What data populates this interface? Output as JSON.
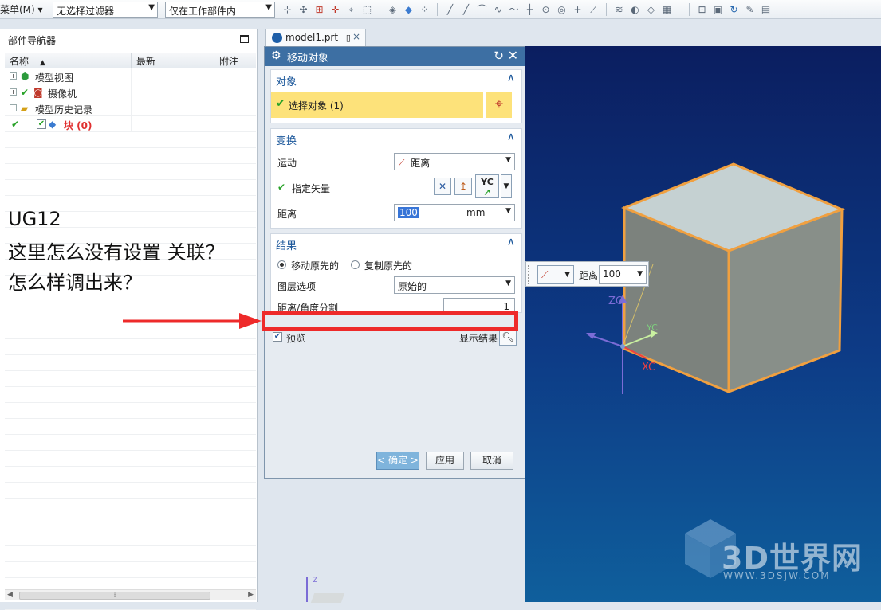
{
  "toolbar": {
    "menu_label": "菜单(M)",
    "filter_value": "无选择过滤器",
    "scope_value": "仅在工作部件内",
    "icons": [
      "snap-icon",
      "point-icon",
      "curve-icon",
      "select-icon",
      "face-icon",
      "body-icon",
      "line-icon",
      "arc-icon",
      "spline-icon",
      "circle-icon",
      "plus-icon",
      "layer-icon",
      "view-icon",
      "refresh-icon",
      "brush-icon"
    ]
  },
  "navigator": {
    "title": "部件导航器",
    "columns": [
      "名称",
      "最新",
      "附注"
    ],
    "rows": [
      {
        "label": "模型视图",
        "indent": 0,
        "expander": "+",
        "icon": "model-view-icon"
      },
      {
        "label": "摄像机",
        "indent": 0,
        "expander": "+",
        "icon": "camera-icon",
        "check": "✔"
      },
      {
        "label": "模型历史记录",
        "indent": 0,
        "expander": "-",
        "icon": "folder-icon"
      },
      {
        "label": "块 (0)",
        "indent": 1,
        "icon": "block-icon",
        "latest": "✔",
        "highlight": true
      }
    ]
  },
  "annotation": {
    "line1": "UG12",
    "line2": "这里怎么没有设置 关联？",
    "line3": "怎么样调出来？"
  },
  "tab": {
    "label": "model1.prt",
    "close": "×"
  },
  "dialog": {
    "title": "移动对象",
    "section_object": {
      "title": "对象",
      "select_label": "选择对象 (1)"
    },
    "section_transform": {
      "title": "变换",
      "motion_label": "运动",
      "motion_value": "距离",
      "vector_label": "指定矢量",
      "vector_value": "YC",
      "distance_label": "距离",
      "distance_value": "100",
      "distance_unit": "mm"
    },
    "section_result": {
      "title": "结果",
      "radio_move": "移动原先的",
      "radio_copy": "复制原先的",
      "layer_label": "图层选项",
      "layer_value": "原始的",
      "split_label": "距离/角度分割",
      "split_value": "1"
    },
    "preview_label": "预览",
    "show_result_label": "显示结果",
    "buttons": {
      "ok": "< 确定 >",
      "apply": "应用",
      "cancel": "取消"
    }
  },
  "float_bar": {
    "distance_label": "距离",
    "distance_value": "100"
  },
  "viewport": {
    "axis_z": "ZC",
    "axis_x": "XC",
    "axis_y": "YC",
    "axis_z_small": "Z"
  },
  "watermark": {
    "title": "3D世界网",
    "url": "WWW.3DSJW.COM"
  },
  "colors": {
    "dialog_title_bg": "#3d6fa3",
    "selection_highlight": "#fde27a",
    "annotation_red": "#ee2a2a",
    "viewport_top": "#0b1e60",
    "viewport_bottom": "#0f5f9c",
    "cube_edge": "#f0a040"
  }
}
